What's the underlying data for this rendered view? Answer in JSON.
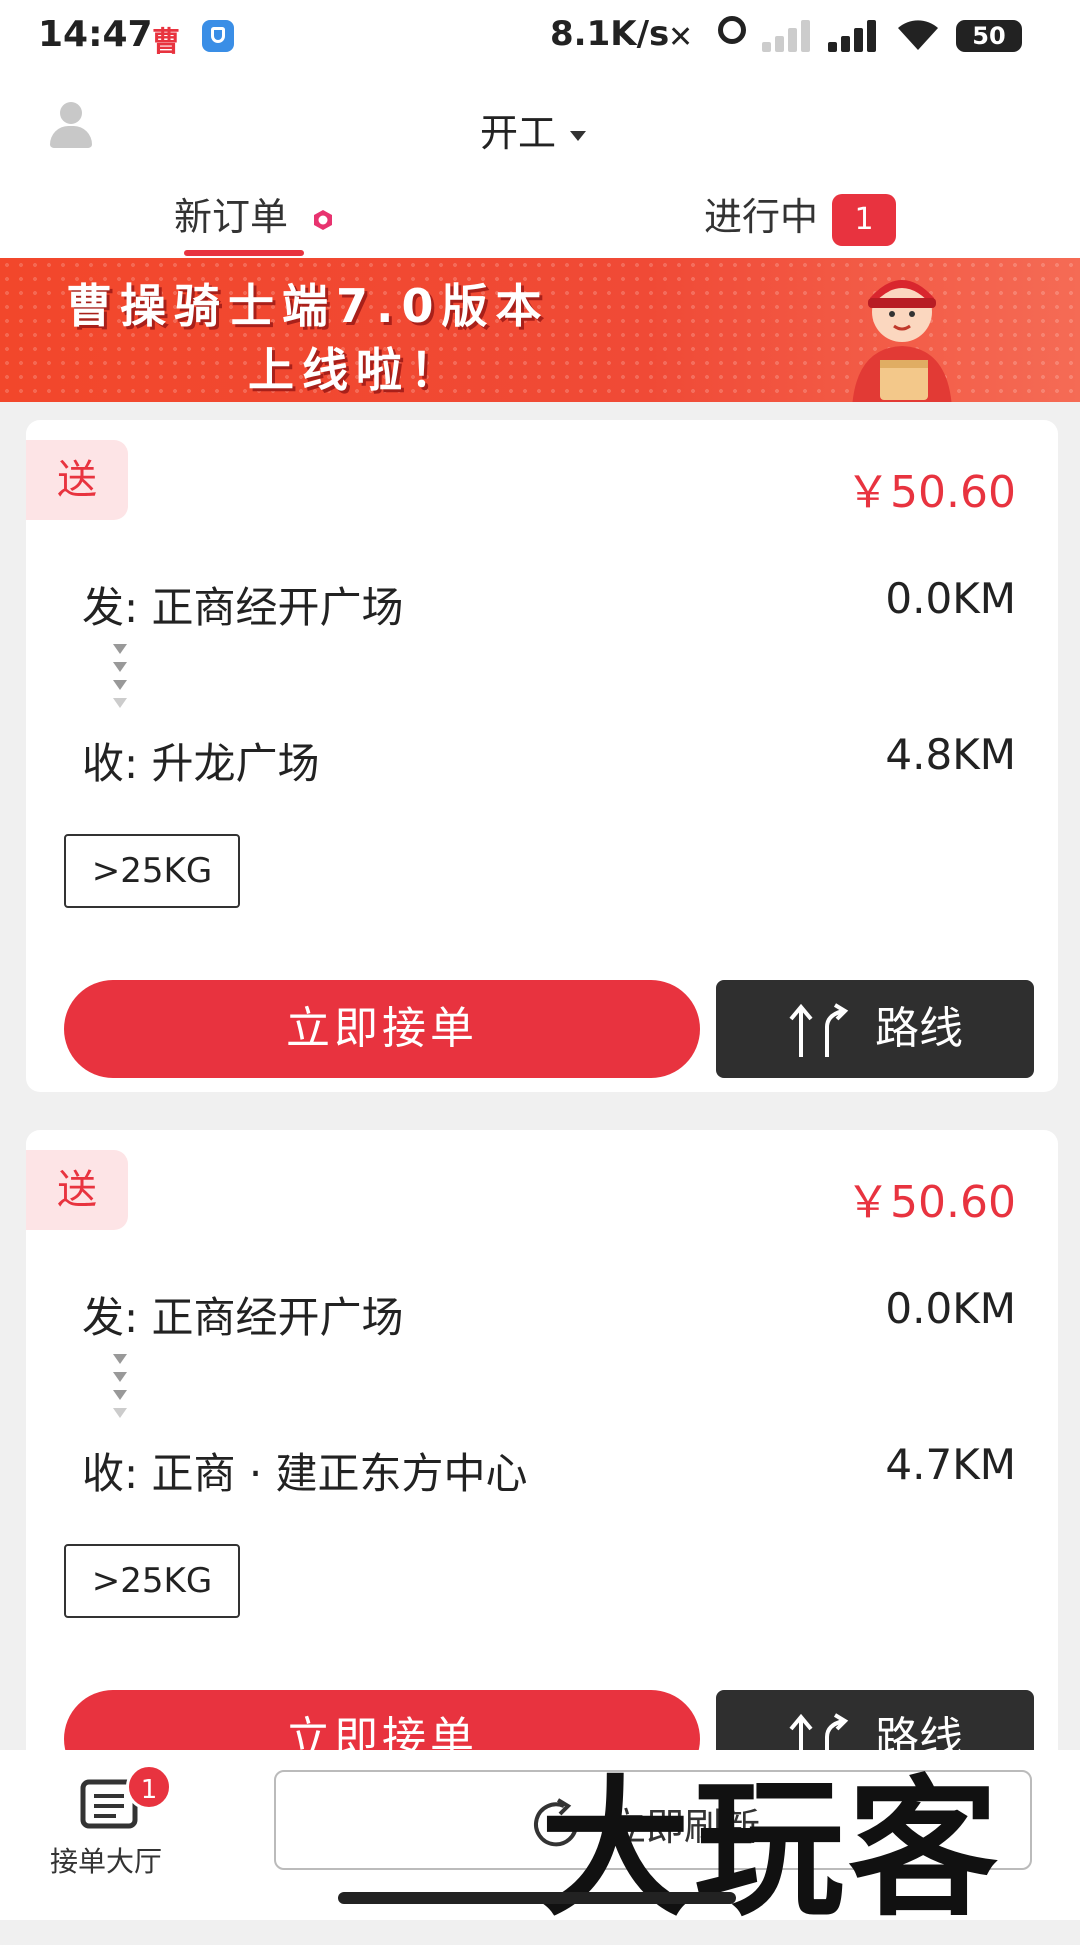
{
  "status_bar": {
    "time": "14:47",
    "app_icon_a": "曹",
    "network_speed": "8.1K/s",
    "battery": "50"
  },
  "header": {
    "work_status": "开工",
    "tabs": [
      {
        "label": "新订单"
      },
      {
        "label": "进行中",
        "badge": "1"
      }
    ]
  },
  "banner": {
    "line1": "曹操骑士端7.0版本",
    "line2": "上线啦！"
  },
  "orders": [
    {
      "type": "送",
      "price": "￥50.60",
      "from": "发: 正商经开广场",
      "from_distance": "0.0KM",
      "to": "收: 升龙广场",
      "to_distance": "4.8KM",
      "weight": ">25KG",
      "accept_label": "立即接单",
      "route_label": "路线"
    },
    {
      "type": "送",
      "price": "￥50.60",
      "from": "发: 正商经开广场",
      "from_distance": "0.0KM",
      "to": "收: 正商 · 建正东方中心",
      "to_distance": "4.7KM",
      "weight": ">25KG",
      "accept_label": "立即接单",
      "route_label": "路线"
    }
  ],
  "bottom_bar": {
    "hall_label": "接单大厅",
    "hall_badge": "1",
    "refresh_label": "立即刷新"
  },
  "watermark": "大玩客",
  "colors": {
    "accent": "#e8333f",
    "dark_button": "#2f2f2f",
    "tag_bg": "#fde4e6"
  },
  "icons": [
    "user-avatar-icon",
    "caret-down-icon",
    "hexagon-dot-icon",
    "route-arrows-icon",
    "order-list-icon",
    "refresh-icon"
  ]
}
